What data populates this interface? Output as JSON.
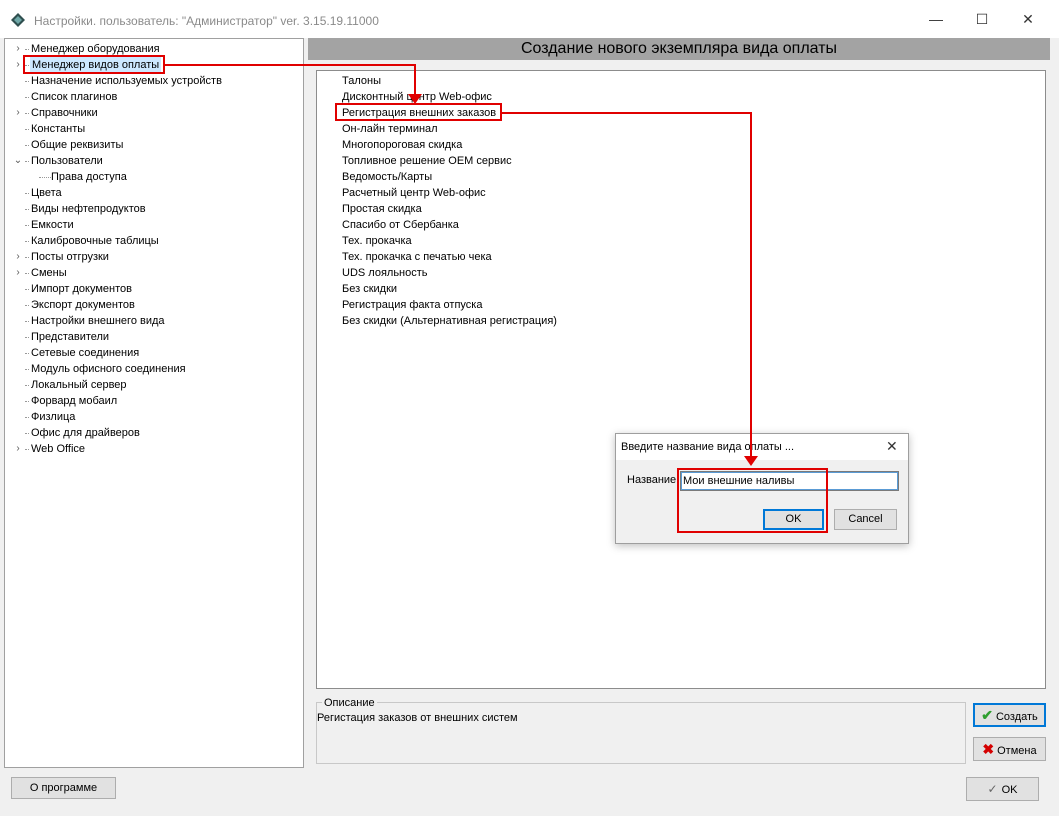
{
  "window": {
    "title": "Настройки. пользователь: \"Администратор\" ver. 3.15.19.11000",
    "minimize_glyph": "—",
    "maximize_glyph": "☐",
    "close_glyph": "✕"
  },
  "tree": {
    "items": [
      {
        "label": "Менеджер оборудования",
        "expander": "›"
      },
      {
        "label": "Менеджер видов оплаты",
        "expander": "›",
        "selected": true
      },
      {
        "label": "Назначение используемых устройств",
        "expander": ""
      },
      {
        "label": "Список плагинов",
        "expander": ""
      },
      {
        "label": "Справочники",
        "expander": "›"
      },
      {
        "label": "Константы",
        "expander": ""
      },
      {
        "label": "Общие реквизиты",
        "expander": ""
      },
      {
        "label": "Пользователи",
        "expander": "⌄"
      },
      {
        "label": "Права доступа",
        "expander": "",
        "child": true
      },
      {
        "label": "Цвета",
        "expander": ""
      },
      {
        "label": "Виды нефтепродуктов",
        "expander": ""
      },
      {
        "label": "Емкости",
        "expander": ""
      },
      {
        "label": "Калибровочные таблицы",
        "expander": ""
      },
      {
        "label": "Посты отгрузки",
        "expander": "›"
      },
      {
        "label": "Смены",
        "expander": "›"
      },
      {
        "label": "Импорт документов",
        "expander": ""
      },
      {
        "label": "Экспорт документов",
        "expander": ""
      },
      {
        "label": "Настройки внешнего вида",
        "expander": ""
      },
      {
        "label": "Представители",
        "expander": ""
      },
      {
        "label": "Сетевые соединения",
        "expander": ""
      },
      {
        "label": "Модуль офисного соединения",
        "expander": ""
      },
      {
        "label": "Локальный сервер",
        "expander": ""
      },
      {
        "label": "Форвард мобаил",
        "expander": ""
      },
      {
        "label": "Физлица",
        "expander": ""
      },
      {
        "label": "Офис для драйверов",
        "expander": ""
      },
      {
        "label": "Web Office",
        "expander": "›"
      }
    ]
  },
  "content": {
    "header": "Создание нового экземпляра вида оплаты",
    "payment_types": [
      "Талоны",
      "Дисконтный центр Web-офис",
      "Регистрация внешних заказов",
      "Он-лайн терминал",
      "Многопороговая скидка",
      "Топливное решение OEM сервис",
      "Ведомость/Карты",
      "Расчетный центр Web-офис",
      "Простая скидка",
      "Спасибо от Сбербанка",
      "Тех. прокачка",
      "Тех. прокачка с печатью чека",
      "UDS лояльность",
      "Без скидки",
      "Регистрация факта отпуска",
      "Без скидки (Альтернативная регистрация)"
    ],
    "description_title": "Описание",
    "description_text": "Регистация заказов от внешних систем",
    "create_label": "Создать",
    "cancel_label": "Отмена"
  },
  "footer": {
    "about_label": "О программе",
    "ok_label": "OK"
  },
  "dialog": {
    "title": "Введите название вида оплаты ...",
    "close_glyph": "✕",
    "name_label": "Название",
    "name_value": "Мои внешние наливы",
    "ok_label": "OK",
    "cancel_label": "Cancel"
  },
  "colors": {
    "annotation": "#e00000",
    "selection": "#cde8ff",
    "header_bg": "#a3a3a3",
    "create_check": "#2e9e2e",
    "cancel_cross": "#d40000"
  }
}
